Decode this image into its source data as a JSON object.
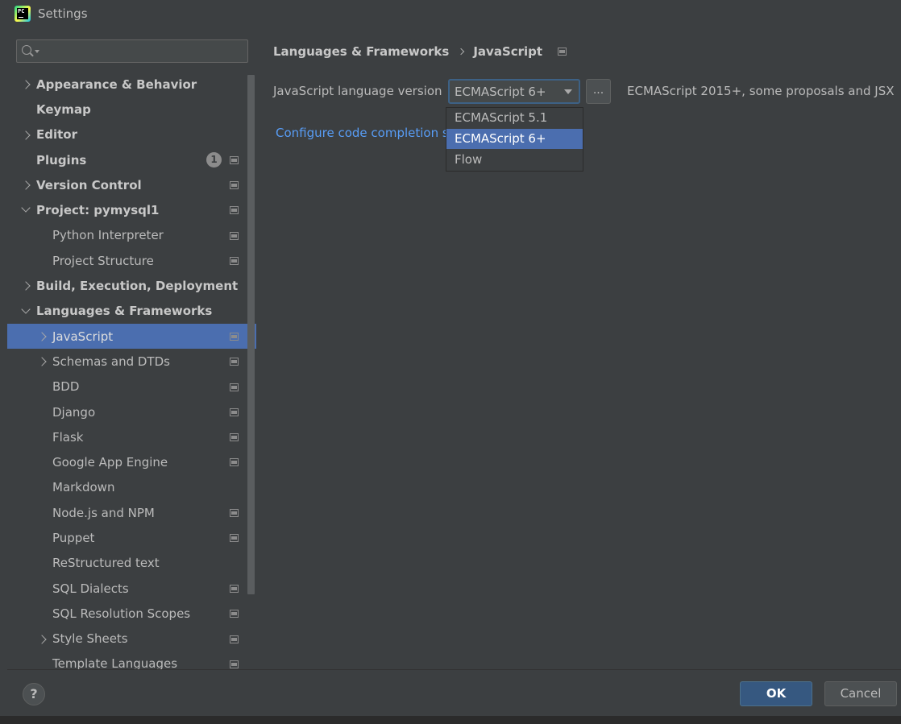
{
  "window": {
    "title": "Settings",
    "icon_text": "PC"
  },
  "search": {
    "placeholder": "",
    "value": ""
  },
  "sidebar": {
    "items": [
      {
        "label": "Appearance & Behavior",
        "level": 0,
        "arrow": "collapsed"
      },
      {
        "label": "Keymap",
        "level": 0,
        "arrow": "none"
      },
      {
        "label": "Editor",
        "level": 0,
        "arrow": "collapsed"
      },
      {
        "label": "Plugins",
        "level": 0,
        "arrow": "none",
        "badge": "1",
        "project_icon": true
      },
      {
        "label": "Version Control",
        "level": 0,
        "arrow": "collapsed",
        "project_icon": true
      },
      {
        "label": "Project: pymysql1",
        "level": 0,
        "arrow": "expanded",
        "project_icon": true
      },
      {
        "label": "Python Interpreter",
        "level": 1,
        "arrow": "none",
        "project_icon": true
      },
      {
        "label": "Project Structure",
        "level": 1,
        "arrow": "none",
        "project_icon": true
      },
      {
        "label": "Build, Execution, Deployment",
        "level": 0,
        "arrow": "collapsed"
      },
      {
        "label": "Languages & Frameworks",
        "level": 0,
        "arrow": "expanded"
      },
      {
        "label": "JavaScript",
        "level": 1,
        "arrow": "collapsed",
        "project_icon": true,
        "selected": true
      },
      {
        "label": "Schemas and DTDs",
        "level": 1,
        "arrow": "collapsed",
        "project_icon": true
      },
      {
        "label": "BDD",
        "level": 1,
        "arrow": "none",
        "project_icon": true
      },
      {
        "label": "Django",
        "level": 1,
        "arrow": "none",
        "project_icon": true
      },
      {
        "label": "Flask",
        "level": 1,
        "arrow": "none",
        "project_icon": true
      },
      {
        "label": "Google App Engine",
        "level": 1,
        "arrow": "none",
        "project_icon": true
      },
      {
        "label": "Markdown",
        "level": 1,
        "arrow": "none"
      },
      {
        "label": "Node.js and NPM",
        "level": 1,
        "arrow": "none",
        "project_icon": true
      },
      {
        "label": "Puppet",
        "level": 1,
        "arrow": "none",
        "project_icon": true
      },
      {
        "label": "ReStructured text",
        "level": 1,
        "arrow": "none"
      },
      {
        "label": "SQL Dialects",
        "level": 1,
        "arrow": "none",
        "project_icon": true
      },
      {
        "label": "SQL Resolution Scopes",
        "level": 1,
        "arrow": "none",
        "project_icon": true
      },
      {
        "label": "Style Sheets",
        "level": 1,
        "arrow": "collapsed",
        "project_icon": true
      },
      {
        "label": "Template Languages",
        "level": 1,
        "arrow": "none",
        "project_icon": true
      }
    ]
  },
  "main": {
    "breadcrumb": [
      "Languages & Frameworks",
      "JavaScript"
    ],
    "language_version_label": "JavaScript language version",
    "language_version_value": "ECMAScript 6+",
    "more_button": "...",
    "language_version_description": "ECMAScript 2015+, some proposals and JSX",
    "configure_link": "Configure code completion s",
    "dropdown_options": [
      {
        "label": "ECMAScript 5.1",
        "selected": false
      },
      {
        "label": "ECMAScript 6+",
        "selected": true
      },
      {
        "label": "Flow",
        "selected": false
      }
    ]
  },
  "footer": {
    "help": "?",
    "ok": "OK",
    "cancel": "Cancel"
  },
  "colors": {
    "background": "#3c3f41",
    "selection": "#4b6eaf",
    "link": "#589df6",
    "ok_button": "#365880"
  }
}
